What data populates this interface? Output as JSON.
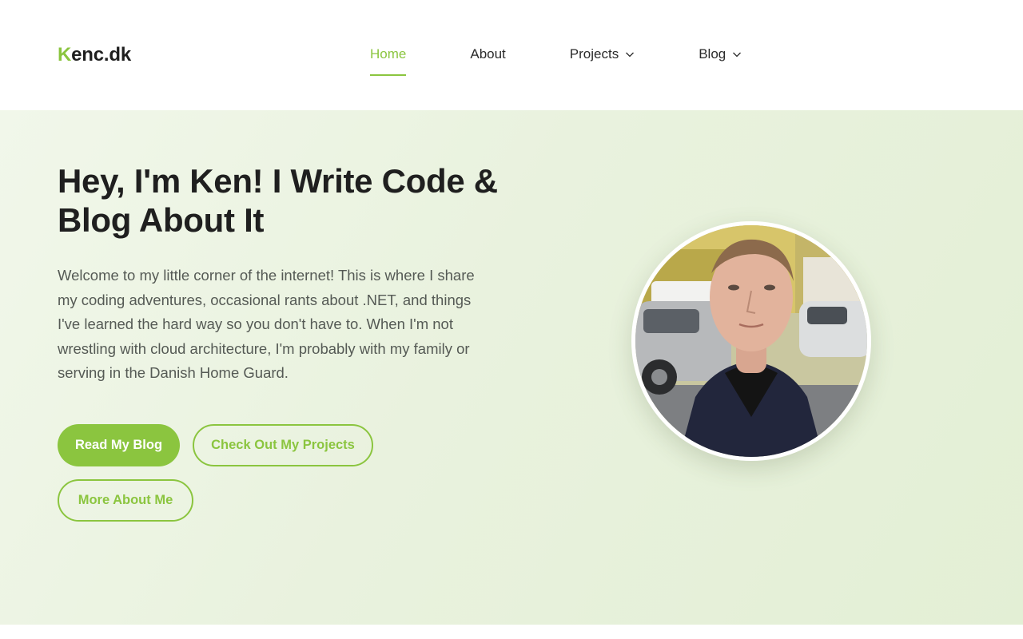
{
  "colors": {
    "accent": "#8bc53f",
    "text": "#1f1f1f",
    "muted": "#555a55"
  },
  "header": {
    "logo_first": "K",
    "logo_rest": "enc.dk",
    "nav": [
      {
        "label": "Home",
        "active": true
      },
      {
        "label": "About"
      },
      {
        "label": "Projects",
        "icon": "chevron-down-icon"
      },
      {
        "label": "Blog",
        "icon": "chevron-down-icon"
      }
    ]
  },
  "hero": {
    "title": "Hey, I'm Ken! I Write Code & Blog About It",
    "text": "Welcome to my little corner of the internet! This is where I share my coding adventures, occasional rants about .NET, and things I've learned the hard way so you don't have to. When I'm not wrestling with cloud architecture, I'm probably with my family or serving in the Danish Home Guard.",
    "buttons": {
      "blog": "Read My Blog",
      "projects": "Check Out My Projects",
      "about": "More About Me"
    },
    "avatar": "profile-photo"
  }
}
